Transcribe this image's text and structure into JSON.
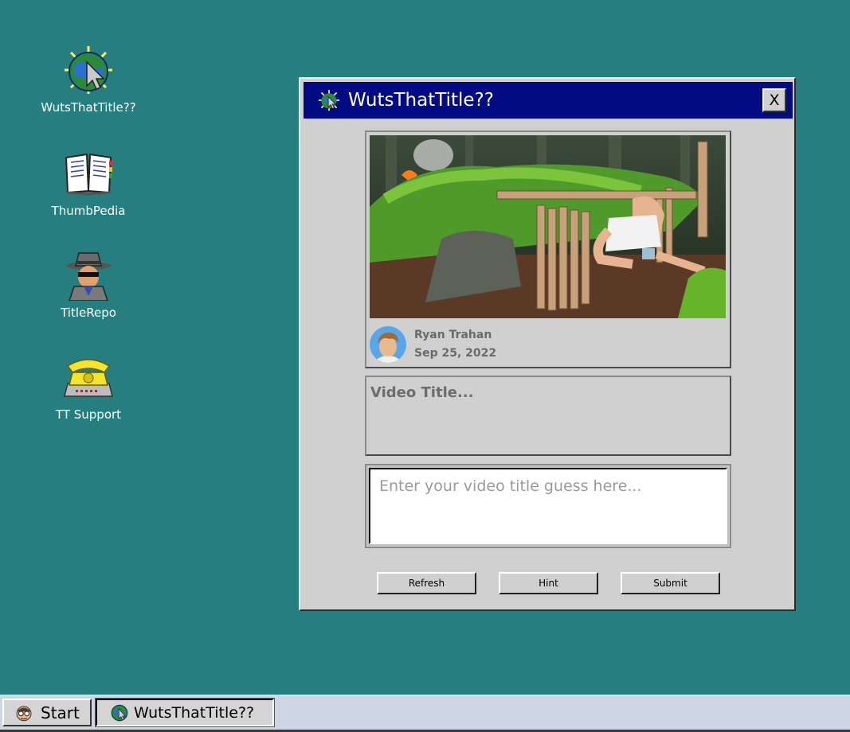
{
  "desktop": {
    "icons": [
      {
        "label": "WutsThatTitle??",
        "icon": "globe-cursor-icon"
      },
      {
        "label": "ThumbPedia",
        "icon": "open-book-icon"
      },
      {
        "label": "TitleRepo",
        "icon": "spy-detective-icon"
      },
      {
        "label": "TT Support",
        "icon": "telephone-icon"
      }
    ]
  },
  "window": {
    "title": "WutsThatTitle??",
    "close_label": "X",
    "video": {
      "thumbnail": "survival-shelter-thumbnail",
      "channel": "Ryan Trahan",
      "date": "Sep 25, 2022"
    },
    "title_box": "Video Title...",
    "guess_placeholder": "Enter your video title guess here...",
    "buttons": {
      "refresh": "Refresh",
      "hint": "Hint",
      "submit": "Submit"
    }
  },
  "taskbar": {
    "start_label": "Start",
    "task_label": "WutsThatTitle??"
  },
  "colors": {
    "desktop": "#267f7e",
    "titlebar": "#020a84",
    "window_face": "#d0d0d0",
    "taskbar": "#cdd6e2"
  }
}
